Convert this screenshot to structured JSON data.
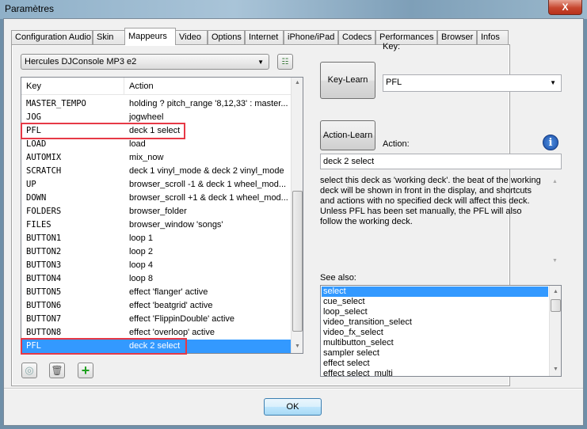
{
  "window": {
    "title": "Paramètres",
    "close_label": "X"
  },
  "tabs": [
    "Configuration Audio",
    "Skin",
    "Mappeurs",
    "Video",
    "Options",
    "Internet",
    "iPhone/iPad",
    "Codecs",
    "Performances",
    "Browser",
    "Infos"
  ],
  "active_tab": "Mappeurs",
  "device_combo": {
    "value": "Hercules DJConsole MP3 e2"
  },
  "mapping_list": {
    "columns": {
      "key": "Key",
      "action": "Action"
    },
    "rows": [
      {
        "key": "MASTER_TEMPO",
        "action": "holding ? pitch_range '8,12,33' : master..."
      },
      {
        "key": "JOG",
        "action": "jogwheel"
      },
      {
        "key": "PFL",
        "action": "deck 1 select",
        "highlight": true
      },
      {
        "key": "LOAD",
        "action": "load"
      },
      {
        "key": "AUTOMIX",
        "action": "mix_now"
      },
      {
        "key": "SCRATCH",
        "action": "deck 1 vinyl_mode & deck 2 vinyl_mode"
      },
      {
        "key": "UP",
        "action": "browser_scroll -1 & deck 1 wheel_mod..."
      },
      {
        "key": "DOWN",
        "action": "browser_scroll +1 & deck 1 wheel_mod..."
      },
      {
        "key": "FOLDERS",
        "action": "browser_folder"
      },
      {
        "key": "FILES",
        "action": "browser_window 'songs'"
      },
      {
        "key": "BUTTON1",
        "action": "loop 1"
      },
      {
        "key": "BUTTON2",
        "action": "loop 2"
      },
      {
        "key": "BUTTON3",
        "action": "loop 4"
      },
      {
        "key": "BUTTON4",
        "action": "loop 8"
      },
      {
        "key": "BUTTON5",
        "action": "effect 'flanger' active"
      },
      {
        "key": "BUTTON6",
        "action": "effect 'beatgrid' active"
      },
      {
        "key": "BUTTON7",
        "action": "effect 'FlippinDouble' active"
      },
      {
        "key": "BUTTON8",
        "action": "effect 'overloop' active"
      },
      {
        "key": "PFL",
        "action": "deck 2 select",
        "selected": true,
        "highlight": true
      }
    ]
  },
  "right": {
    "key_learn": "Key-Learn",
    "key_label": "Key:",
    "key_value": "PFL",
    "action_learn": "Action-Learn",
    "action_label": "Action:",
    "action_value": "deck 2 select",
    "description": "select this deck as 'working deck'. the beat of the working deck will be shown in front in the display, and shortcuts and actions with no specified deck will affect this deck.\nUnless PFL has been set manually, the PFL will also follow the working deck.",
    "see_also_label": "See also:",
    "see_also": [
      "select",
      "cue_select",
      "loop_select",
      "video_transition_select",
      "video_fx_select",
      "multibutton_select",
      "sampler select",
      "effect select",
      "effect select_multi"
    ],
    "see_also_selected": "select"
  },
  "ok_label": "OK",
  "colors": {
    "selection": "#3399ff",
    "highlight_box": "#e63946"
  }
}
